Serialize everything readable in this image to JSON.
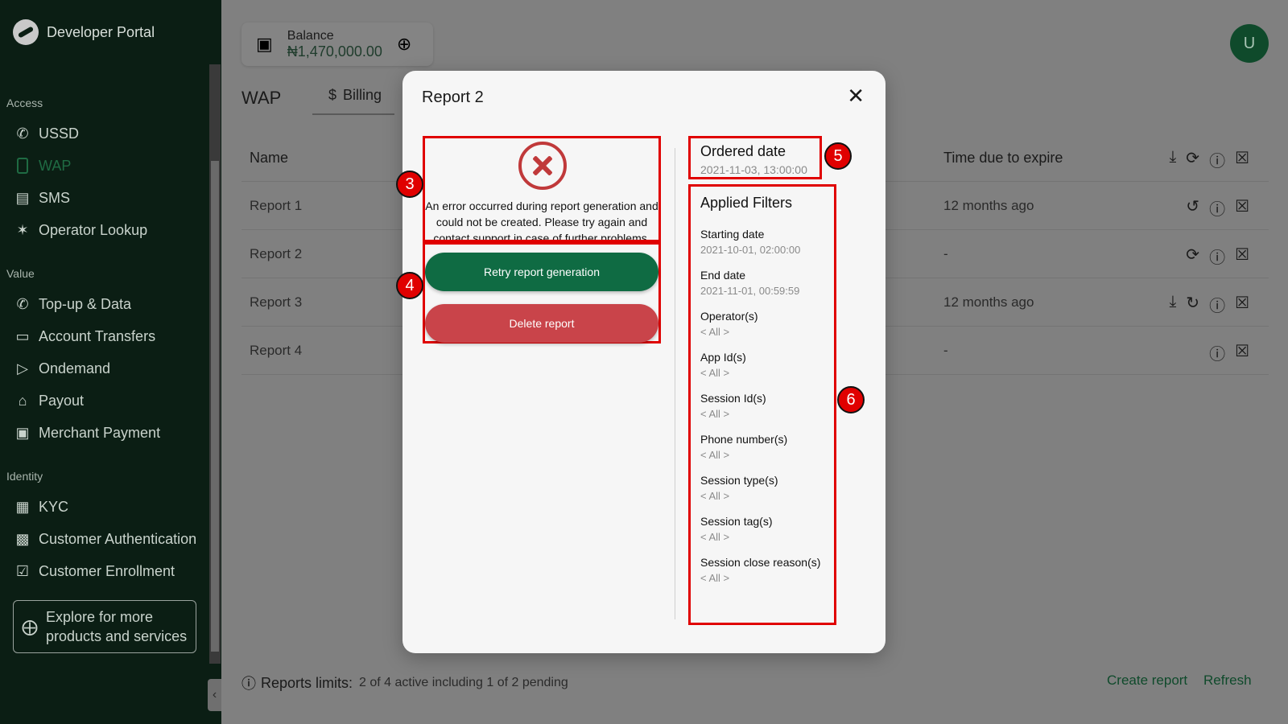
{
  "app": {
    "title": "Developer Portal"
  },
  "sidebar": {
    "sections": [
      {
        "label": "Access",
        "items": [
          {
            "label": "USSD",
            "icon": "phone-forward-icon"
          },
          {
            "label": "WAP",
            "icon": "mobile-icon",
            "active": true
          },
          {
            "label": "SMS",
            "icon": "message-icon"
          },
          {
            "label": "Operator Lookup",
            "icon": "antenna-icon"
          }
        ]
      },
      {
        "label": "Value",
        "items": [
          {
            "label": "Top-up & Data",
            "icon": "phone-transfer-icon"
          },
          {
            "label": "Account Transfers",
            "icon": "card-icon"
          },
          {
            "label": "Ondemand",
            "icon": "play-box-icon"
          },
          {
            "label": "Payout",
            "icon": "bank-icon"
          },
          {
            "label": "Merchant Payment",
            "icon": "cash-icon"
          }
        ]
      },
      {
        "label": "Identity",
        "items": [
          {
            "label": "KYC",
            "icon": "chart-box-icon"
          },
          {
            "label": "Customer Authentication",
            "icon": "badge-icon"
          },
          {
            "label": "Customer Enrollment",
            "icon": "clipboard-check-icon"
          }
        ]
      }
    ],
    "explore": "Explore for more products and services"
  },
  "header": {
    "balance_label": "Balance",
    "balance_value": "₦1,470,000.00",
    "avatar_initial": "U"
  },
  "tabs": {
    "wap": "WAP",
    "billing": "Billing"
  },
  "table": {
    "col_name": "Name",
    "col_due": "Time due to expire",
    "rows": [
      {
        "name": "Report 1",
        "due": "12 months ago"
      },
      {
        "name": "Report 2",
        "due": "-"
      },
      {
        "name": "Report 3",
        "due": "12 months ago"
      },
      {
        "name": "Report 4",
        "due": "-"
      }
    ]
  },
  "footer": {
    "limits_label": "Reports limits:",
    "limits_value": "2 of 4 active including 1 of 2 pending",
    "create": "Create report",
    "refresh": "Refresh"
  },
  "modal": {
    "title": "Report 2",
    "error_text": "An error occurred during report generation and could not be created. Please try again and contact support in case of further problems.",
    "retry": "Retry report generation",
    "delete": "Delete report",
    "ordered_label": "Ordered date",
    "ordered_value": "2021-11-03, 13:00:00",
    "filters_title": "Applied Filters",
    "filters": [
      {
        "label": "Starting date",
        "value": "2021-10-01, 02:00:00"
      },
      {
        "label": "End date",
        "value": "2021-11-01, 00:59:59"
      },
      {
        "label": "Operator(s)",
        "value": "< All >"
      },
      {
        "label": "App Id(s)",
        "value": "< All >"
      },
      {
        "label": "Session Id(s)",
        "value": "< All >"
      },
      {
        "label": "Phone number(s)",
        "value": "< All >"
      },
      {
        "label": "Session type(s)",
        "value": "< All >"
      },
      {
        "label": "Session tag(s)",
        "value": "< All >"
      },
      {
        "label": "Session close reason(s)",
        "value": "< All >"
      }
    ]
  },
  "markers": [
    "3",
    "4",
    "5",
    "6"
  ],
  "colors": {
    "sidebar_bg": "#0b1e14",
    "accent": "#0f6b43",
    "danger": "#c9444a",
    "marker": "#e00000"
  }
}
